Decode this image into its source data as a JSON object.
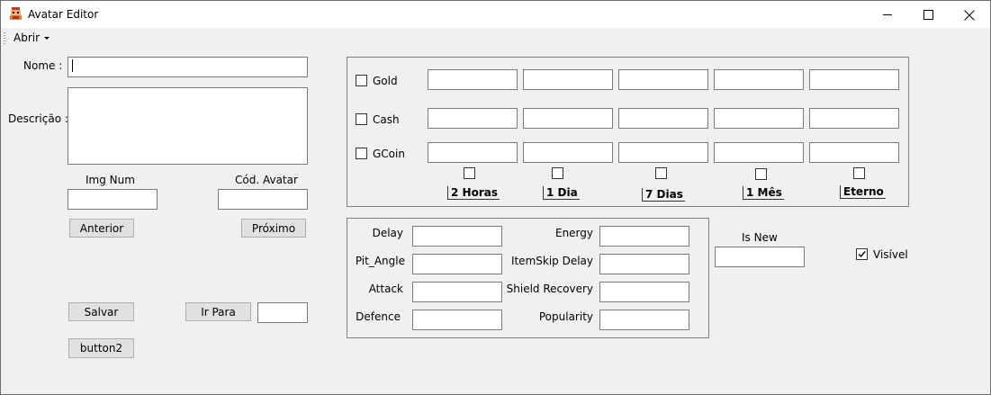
{
  "window": {
    "title": "Avatar Editor",
    "minimize_icon": "minimize-icon",
    "maximize_icon": "maximize-icon",
    "close_icon": "close-icon"
  },
  "menu": {
    "abrir": "Abrir"
  },
  "form": {
    "nome_label": "Nome :",
    "nome_value": "",
    "descricao_label": "Descrição :",
    "descricao_value": "",
    "img_num_label": "Img Num",
    "img_num_value": "",
    "cod_avatar_label": "Cód. Avatar",
    "cod_avatar_value": "",
    "anterior": "Anterior",
    "proximo": "Próximo",
    "salvar": "Salvar",
    "ir_para": "Ir Para",
    "ir_para_value": "",
    "button2": "button2"
  },
  "prices": {
    "rows": [
      {
        "label": "Gold",
        "checked": false
      },
      {
        "label": "Cash",
        "checked": false
      },
      {
        "label": "GCoin",
        "checked": false
      }
    ],
    "periods": [
      "2 Horas",
      "1 Dia",
      "7 Dias",
      "1 Mês",
      "Eterno"
    ]
  },
  "stats": {
    "left": [
      "Delay",
      "Pit_Angle",
      "Attack",
      "Defence"
    ],
    "right": [
      "Energy",
      "ItemSkip Delay",
      "Shield Recovery",
      "Popularity"
    ]
  },
  "extra": {
    "is_new_label": "Is New",
    "is_new_value": "",
    "visivel_label": "Visível",
    "visivel_checked": true
  }
}
